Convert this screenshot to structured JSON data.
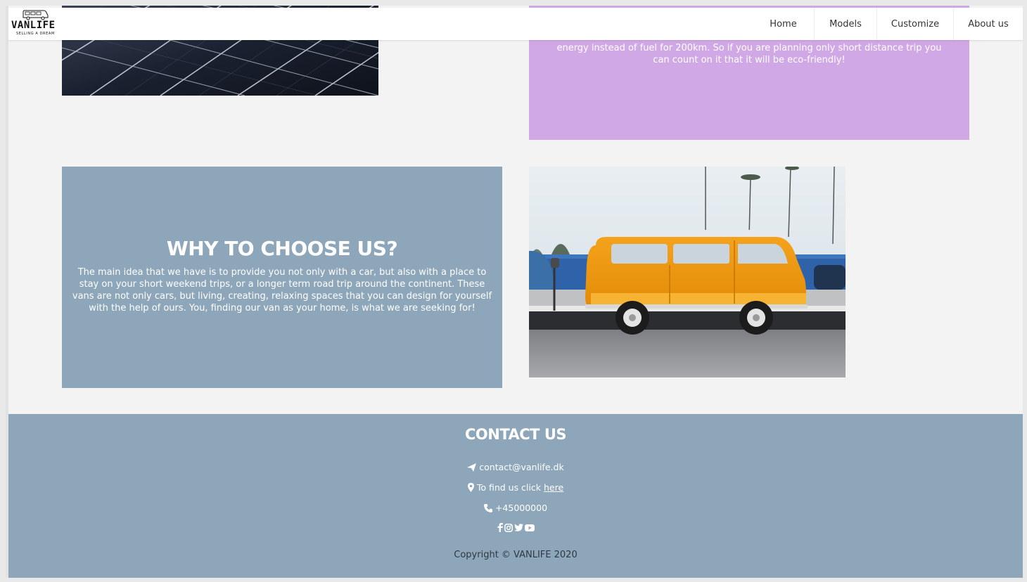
{
  "header": {
    "logo_title": "VANLIFE",
    "logo_subtitle": "SELLING A DREAM",
    "nav": [
      {
        "label": "Home"
      },
      {
        "label": "Models"
      },
      {
        "label": "Customize"
      },
      {
        "label": "About us"
      }
    ]
  },
  "purple_box": {
    "text": "energy instead of fuel for 200km. So if you are planning only short distance trip you can count on it that it will be eco-friendly!"
  },
  "why": {
    "title": "WHY TO CHOOSE US?",
    "text": "The main idea that we have is to provide you not only with a car, but also with a place to stay on your short weekend trips, or a longer term road trip around the continent. These vans are not only cars, but living, creating, relaxing spaces that you can design for yourself with the help of ours. You, finding our van as your home, is what we are seeking for!"
  },
  "footer": {
    "title": "CONTACT US",
    "email": "contact@vanlife.dk",
    "find_text": "To find us click",
    "find_link": "here",
    "phone": "+45000000",
    "copyright": "Copyright © VANLIFE 2020"
  },
  "colors": {
    "purple": "#d0a8e6",
    "blue_gray": "#8ea6b9",
    "page_bg": "#f3f3f3"
  }
}
